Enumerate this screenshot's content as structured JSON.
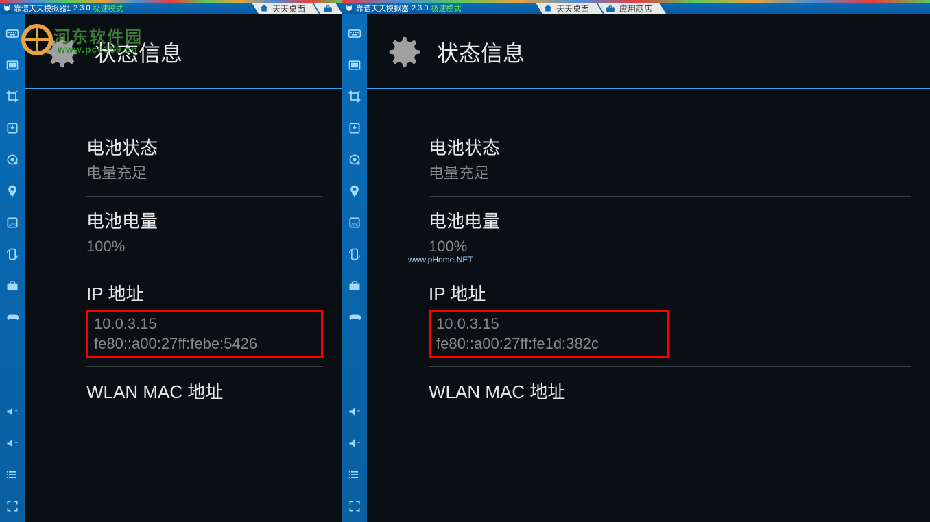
{
  "left": {
    "app_name": "靠谱天天模拟器1",
    "version": "2.3.0",
    "mode": "极速模式",
    "tabs": [
      {
        "label": "天天桌面",
        "icon": "home"
      },
      {
        "label": "",
        "icon": "store",
        "icononly": true
      }
    ],
    "settings_title": "状态信息",
    "items": [
      {
        "label": "电池状态",
        "value": "电量充足"
      },
      {
        "label": "电池电量",
        "value": "100%"
      },
      {
        "label": "IP 地址",
        "ipv4": "10.0.3.15",
        "ipv6": "fe80::a00:27ff:febe:5426",
        "highlight": true
      },
      {
        "label": "WLAN MAC 地址",
        "value": ""
      }
    ],
    "watermark_site": "www.pc0359.cn",
    "watermark_brand": "河东软件园"
  },
  "right": {
    "app_name": "靠谱天天模拟器",
    "version": "2.3.0",
    "mode": "极速模式",
    "tabs": [
      {
        "label": "天天桌面",
        "icon": "home"
      },
      {
        "label": "应用商店",
        "icon": "store"
      }
    ],
    "settings_title": "状态信息",
    "items": [
      {
        "label": "电池状态",
        "value": "电量充足"
      },
      {
        "label": "电池电量",
        "value": "100%"
      },
      {
        "label": "IP 地址",
        "ipv4": "10.0.3.15",
        "ipv6": "fe80::a00:27ff:fe1d:382c",
        "highlight": true
      },
      {
        "label": "WLAN MAC 地址",
        "value": ""
      }
    ],
    "watermark": "www.pHome.NET"
  },
  "sidebar_icons": [
    "keyboard-icon",
    "screenshot-icon",
    "crop-icon",
    "download-icon",
    "camera-icon",
    "location-icon",
    "apk-icon",
    "rotate-icon",
    "toolbox-icon",
    "gamepad-icon"
  ],
  "sidebar_bottom": [
    "volume-up-icon",
    "volume-down-icon",
    "list-icon",
    "fullscreen-icon"
  ]
}
